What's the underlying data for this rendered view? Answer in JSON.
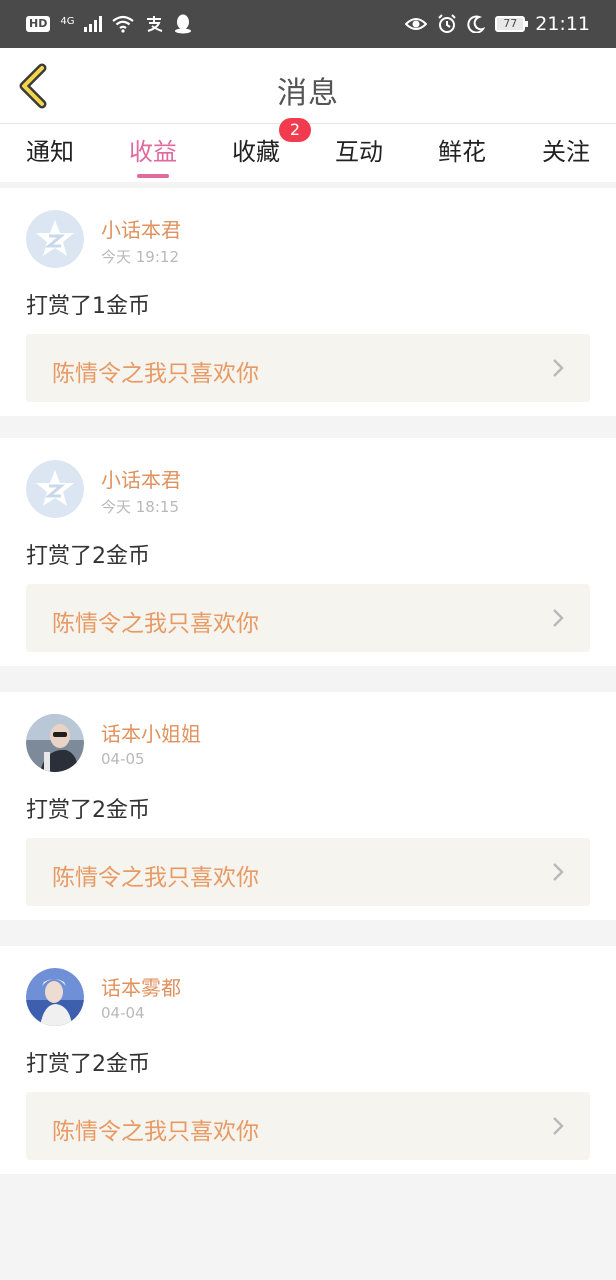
{
  "status_bar": {
    "network_badge": "HD",
    "network_type": "4G",
    "battery": "77",
    "time": "21:11"
  },
  "header": {
    "title": "消息"
  },
  "tabs": [
    {
      "label": "通知"
    },
    {
      "label": "收益"
    },
    {
      "label": "收藏",
      "badge": "2"
    },
    {
      "label": "互动"
    },
    {
      "label": "鲜花"
    },
    {
      "label": "关注"
    }
  ],
  "active_tab": "收益",
  "colors": {
    "accent": "#e06a9e",
    "username": "#e0925e",
    "badge": "#f23b4e",
    "book_link_bg": "#f5f4ee"
  },
  "messages": [
    {
      "user": "小话本君",
      "time": "今天 19:12",
      "text": "打赏了1金币",
      "book": "陈情令之我只喜欢你",
      "avatar_icon": "default-star-avatar"
    },
    {
      "user": "小话本君",
      "time": "今天 18:15",
      "text": "打赏了2金币",
      "book": "陈情令之我只喜欢你",
      "avatar_icon": "default-star-avatar"
    },
    {
      "user": "话本小姐姐",
      "time": "04-05",
      "text": "打赏了2金币",
      "book": "陈情令之我只喜欢你",
      "avatar_icon": "photo-avatar"
    },
    {
      "user": "话本雾都",
      "time": "04-04",
      "text": "打赏了2金币",
      "book": "陈情令之我只喜欢你",
      "avatar_icon": "photo-avatar"
    }
  ]
}
